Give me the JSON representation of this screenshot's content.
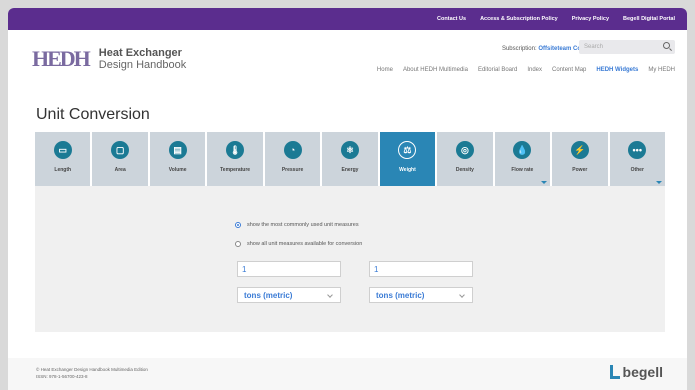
{
  "topbar": {
    "links": [
      "Contact Us",
      "Access & Subscription Policy",
      "Privacy Policy",
      "Begell Digital Portal"
    ]
  },
  "brand": {
    "mark": "HEDH",
    "line1": "Heat Exchanger",
    "line2": "Design Handbook"
  },
  "subscription": {
    "label": "Subscription: ",
    "value": "Offsiteteam Corp"
  },
  "search": {
    "placeholder": "Search"
  },
  "nav": {
    "items": [
      "Home",
      "About HEDH Multimedia",
      "Editorial Board",
      "Index",
      "Content Map",
      "HEDH Widgets",
      "My HEDH"
    ],
    "active": "HEDH Widgets"
  },
  "page": {
    "title": "Unit Conversion"
  },
  "tiles": [
    {
      "label": "Length",
      "icon": "ruler-icon",
      "glyph": "▭"
    },
    {
      "label": "Area",
      "icon": "area-icon",
      "glyph": "▢"
    },
    {
      "label": "Volume",
      "icon": "volume-icon",
      "glyph": "▤"
    },
    {
      "label": "Temperature",
      "icon": "thermometer-icon",
      "glyph": "🌡"
    },
    {
      "label": "Pressure",
      "icon": "pressure-gauge-icon",
      "glyph": "◔"
    },
    {
      "label": "Energy",
      "icon": "atom-icon",
      "glyph": "⚛"
    },
    {
      "label": "Weight",
      "icon": "weight-icon",
      "glyph": "⚖"
    },
    {
      "label": "Density",
      "icon": "density-icon",
      "glyph": "◎"
    },
    {
      "label": "Flow rate",
      "icon": "droplet-icon",
      "glyph": "💧"
    },
    {
      "label": "Power",
      "icon": "lightning-icon",
      "glyph": "⚡"
    },
    {
      "label": "Other",
      "icon": "more-icon",
      "glyph": "•••"
    }
  ],
  "active_tile": "Weight",
  "converter": {
    "radio_common": "show the most commonly used unit measures",
    "radio_all": "show all unit measures available for conversion",
    "selected_radio": "common",
    "left_value": "1",
    "right_value": "1",
    "left_unit": "tons (metric)",
    "right_unit": "tons (metric)"
  },
  "footer": {
    "line1": "© Heat Exchanger Design Handbook Multimedia Edition",
    "line2": "ISSN: 978-1-56700-423-8",
    "publisher": "begell"
  },
  "colors": {
    "topbar": "#5b2d8e",
    "accent": "#2a86b5",
    "link": "#3a7bd5"
  }
}
